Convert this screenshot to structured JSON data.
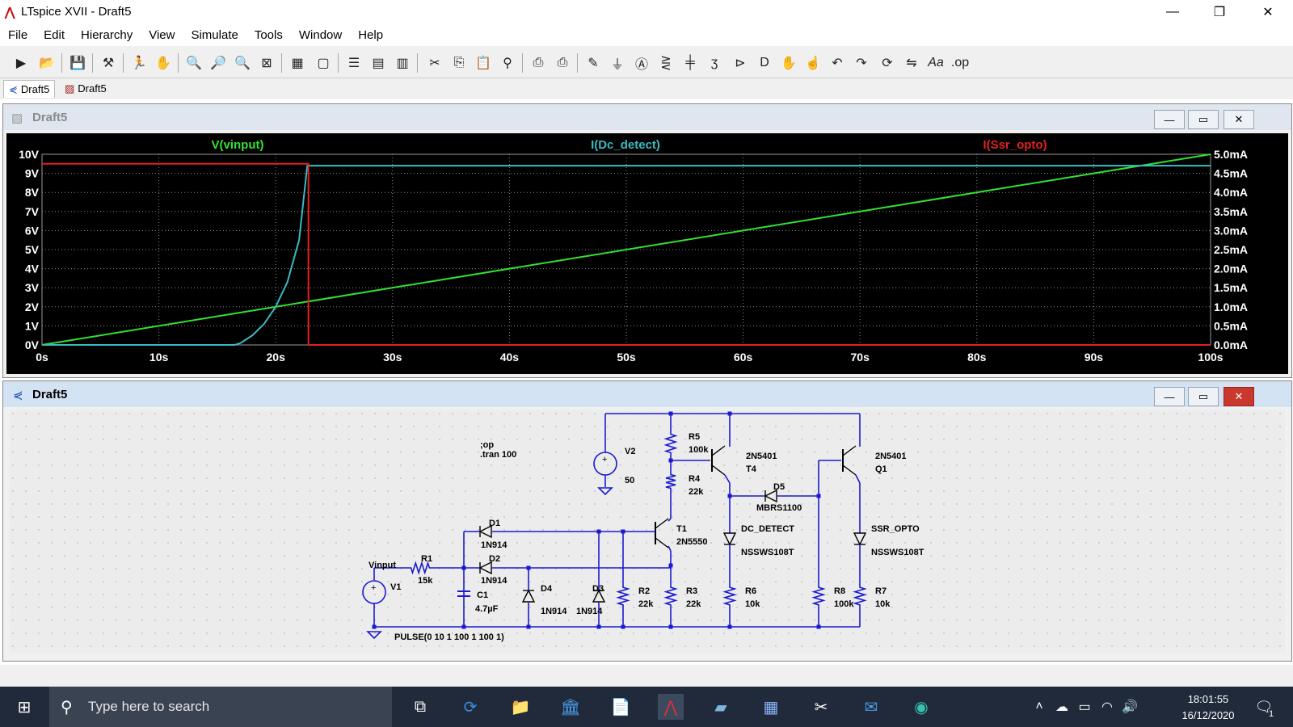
{
  "window": {
    "title": "LTspice XVII - Draft5"
  },
  "menu": [
    "File",
    "Edit",
    "Hierarchy",
    "View",
    "Simulate",
    "Tools",
    "Window",
    "Help"
  ],
  "tabs": [
    {
      "label": "Draft5"
    },
    {
      "label": "Draft5"
    }
  ],
  "plot_window": {
    "title": "Draft5"
  },
  "schematic_window": {
    "title": "Draft5"
  },
  "chart_data": {
    "type": "line",
    "title": "",
    "xlabel": "",
    "x_ticks": [
      "0s",
      "10s",
      "20s",
      "30s",
      "40s",
      "50s",
      "60s",
      "70s",
      "80s",
      "90s",
      "100s"
    ],
    "xlim": [
      0,
      100
    ],
    "left_axis": {
      "ticks": [
        "0V",
        "1V",
        "2V",
        "3V",
        "4V",
        "5V",
        "6V",
        "7V",
        "8V",
        "9V",
        "10V"
      ],
      "ylim": [
        0,
        10
      ]
    },
    "right_axis": {
      "ticks": [
        "0.0mA",
        "0.5mA",
        "1.0mA",
        "1.5mA",
        "2.0mA",
        "2.5mA",
        "3.0mA",
        "3.5mA",
        "4.0mA",
        "4.5mA",
        "5.0mA"
      ],
      "ylim": [
        0,
        5
      ]
    },
    "grid": true,
    "series": [
      {
        "name": "V(vinput)",
        "color": "#33e133",
        "axis": "left",
        "x": [
          0,
          100
        ],
        "y": [
          0,
          10
        ]
      },
      {
        "name": "I(Dc_detect)",
        "color": "#3bbbc4",
        "axis": "right",
        "x": [
          0,
          16.5,
          17,
          18,
          19,
          20,
          21,
          22,
          22.7,
          26,
          100
        ],
        "y": [
          0,
          0,
          0.05,
          0.25,
          0.55,
          1.0,
          1.65,
          2.75,
          4.7,
          4.7,
          4.7
        ]
      },
      {
        "name": "I(Ssr_opto)",
        "color": "#e22020",
        "axis": "right",
        "x": [
          0,
          0.1,
          22.8,
          22.8,
          100
        ],
        "y": [
          4.75,
          4.75,
          4.75,
          0,
          0
        ]
      }
    ]
  },
  "schematic": {
    "labels": {
      "op": ";op",
      "tran": ".tran 100",
      "v2": "V2",
      "v2val": "50",
      "r5": "R5",
      "r5val": "100k",
      "r4": "R4",
      "r4val": "22k",
      "t4model": "2N5401",
      "t4": "T4",
      "q1model": "2N5401",
      "q1": "Q1",
      "d5": "D5",
      "d5val": "MBRS1100",
      "t1": "T1",
      "t1model": "2N5550",
      "dcdet": "DC_DETECT",
      "dcdetval": "NSSWS108T",
      "ssr": "SSR_OPTO",
      "ssrval": "NSSWS108T",
      "d1": "D1",
      "d1val": "1N914",
      "d2": "D2",
      "d2val": "1N914",
      "d3": "D3",
      "d3val": "1N914",
      "d4": "D4",
      "d4val": "1N914",
      "vinput": "Vinput",
      "r1": "R1",
      "r1val": "15k",
      "v1": "V1",
      "c1": "C1",
      "c1val": "4.7µF",
      "r2": "R2",
      "r2val": "22k",
      "r3": "R3",
      "r3val": "22k",
      "r6": "R6",
      "r6val": "10k",
      "r8": "R8",
      "r8val": "100k",
      "r7": "R7",
      "r7val": "10k",
      "pulse": "PULSE(0 10 1 100 1 100 1)"
    }
  },
  "taskbar": {
    "search_placeholder": "Type here to search",
    "time": "18:01:55",
    "date": "16/12/2020",
    "notifications": "1"
  }
}
